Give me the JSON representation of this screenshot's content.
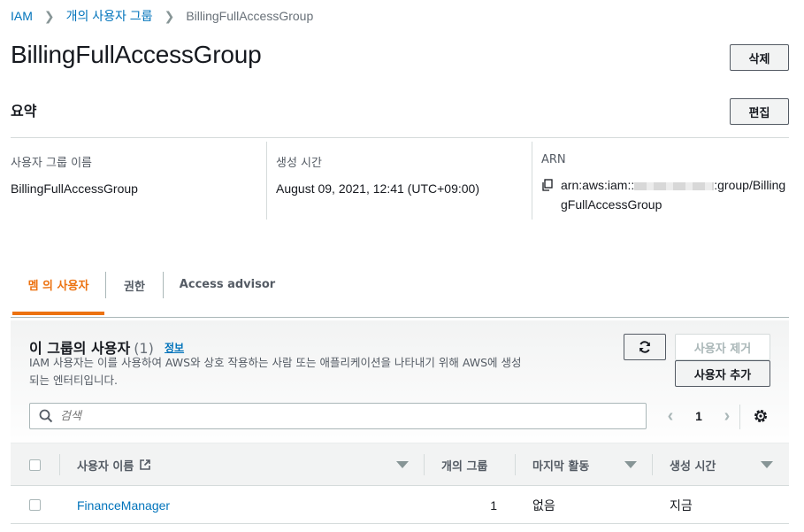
{
  "breadcrumb": {
    "root": "IAM",
    "parent": "개의 사용자 그룹",
    "current": "BillingFullAccessGroup"
  },
  "page": {
    "title": "BillingFullAccessGroup",
    "delete_label": "삭제"
  },
  "summary": {
    "title": "요약",
    "edit_label": "편집",
    "group_name_label": "사용자 그룹 이름",
    "group_name_value": "BillingFullAccessGroup",
    "created_label": "생성 시간",
    "created_value": "August 09, 2021, 12:41 (UTC+09:00)",
    "arn_label": "ARN",
    "arn_prefix": "arn:aws:iam::",
    "arn_suffix": ":group/Billing",
    "arn_suffix2": "gFullAccessGroup"
  },
  "tabs": [
    {
      "label": "멤 의 사용자",
      "active": true
    },
    {
      "label": "권한",
      "active": false
    },
    {
      "label": "Access advisor",
      "active": false
    }
  ],
  "users_panel": {
    "title": "이 그룹의 사용자",
    "count": "(1)",
    "info_label": "정보",
    "description": "IAM 사용자는 이를 사용하여 AWS와 상호 작용하는 사람 또는 애플리케이션을 나타내기 위해 AWS에 생성되는 엔터티입니다.",
    "remove_label": "사용자 제거",
    "add_label": "사용자 추가",
    "search_placeholder": "검색",
    "page_number": "1",
    "columns": {
      "user_name": "사용자 이름",
      "groups": "개의 그룹",
      "last_activity": "마지막 활동",
      "created": "생성 시간"
    },
    "rows": [
      {
        "user_name": "FinanceManager",
        "groups": "1",
        "last_activity": "없음",
        "created": "지금"
      }
    ]
  },
  "colors": {
    "link": "#0073bb",
    "accent": "#ec7211",
    "border": "#d5dbdb"
  }
}
